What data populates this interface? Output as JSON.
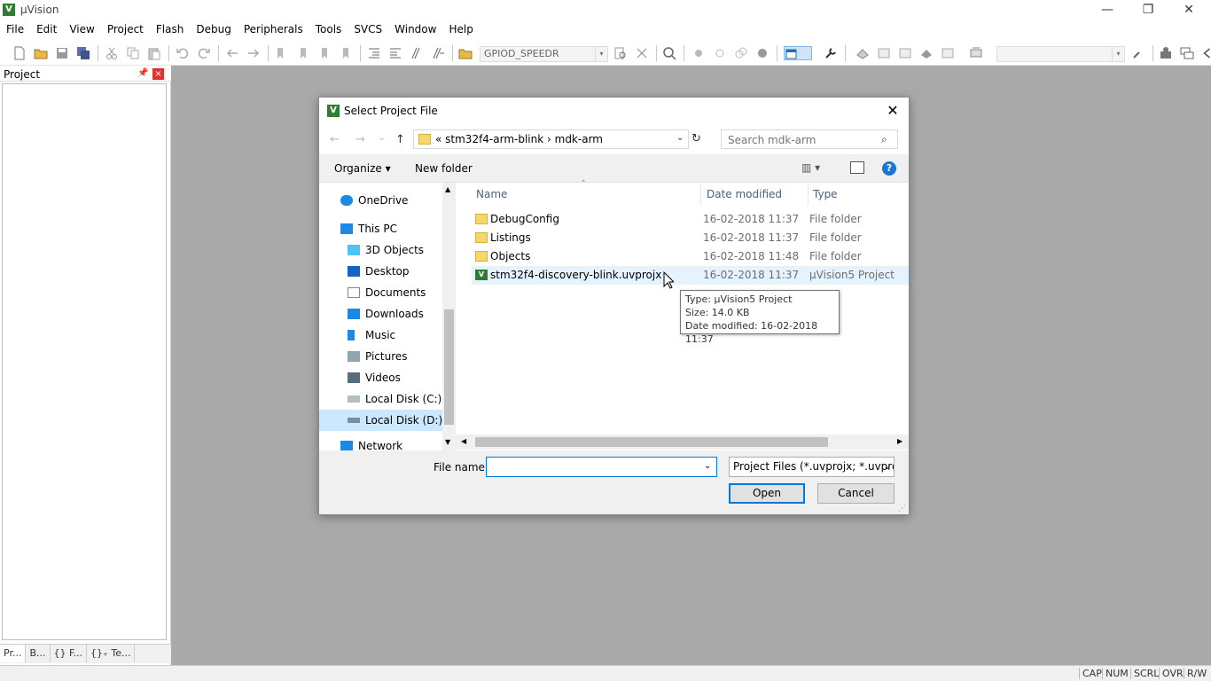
{
  "app": {
    "title": "µVision",
    "logo_letter": "V"
  },
  "window_controls": {
    "minimize": "—",
    "restore": "❐",
    "close": "✕"
  },
  "menu": [
    "File",
    "Edit",
    "View",
    "Project",
    "Flash",
    "Debug",
    "Peripherals",
    "Tools",
    "SVCS",
    "Window",
    "Help"
  ],
  "toolbar": {
    "target": "GPIOD_SPEEDR",
    "combo_arrow": "▾"
  },
  "project_panel": {
    "title": "Project",
    "pin": "📌",
    "close": "×",
    "tabs": [
      "Pr...",
      "B...",
      "{} F...",
      "{}₊ Te..."
    ]
  },
  "status": {
    "cap": "CAP",
    "num": "NUM",
    "scrl": "SCRL",
    "ovr": "OVR",
    "rw": "R/W"
  },
  "dialog": {
    "title": "Select Project File",
    "close": "✕",
    "nav": {
      "back": "←",
      "forward": "→",
      "recent": "⌄",
      "up": "↑"
    },
    "address": {
      "crumb": "«  stm32f4-arm-blink  ›  mdk-arm",
      "dropdown": "⌄",
      "refresh": "↻"
    },
    "search": {
      "placeholder": "Search mdk-arm",
      "icon": "⌕"
    },
    "organize": "Organize ▾",
    "new_folder": "New folder",
    "view": "▥  ▾",
    "help": "?",
    "nav_items": [
      {
        "label": "OneDrive"
      },
      {
        "label": "This PC"
      },
      {
        "label": "3D Objects"
      },
      {
        "label": "Desktop"
      },
      {
        "label": "Documents"
      },
      {
        "label": "Downloads"
      },
      {
        "label": "Music"
      },
      {
        "label": "Pictures"
      },
      {
        "label": "Videos"
      },
      {
        "label": "Local Disk (C:)"
      },
      {
        "label": "Local Disk (D:)",
        "selected": true
      },
      {
        "label": "Network"
      }
    ],
    "columns": {
      "name": "Name",
      "date": "Date modified",
      "type": "Type",
      "sort_arrow": "˄"
    },
    "files": [
      {
        "name": "DebugConfig",
        "date": "16-02-2018 11:37",
        "type": "File folder",
        "icon": "folder-icon"
      },
      {
        "name": "Listings",
        "date": "16-02-2018 11:37",
        "type": "File folder",
        "icon": "folder-icon"
      },
      {
        "name": "Objects",
        "date": "16-02-2018 11:48",
        "type": "File folder",
        "icon": "folder-icon"
      },
      {
        "name": "stm32f4-discovery-blink.uvprojx",
        "date": "16-02-2018 11:37",
        "type": "µVision5 Project",
        "icon": "uvision-project-icon"
      }
    ],
    "tooltip": {
      "type": "Type: µVision5 Project",
      "size": "Size: 14.0 KB",
      "date": "Date modified: 16-02-2018 11:37"
    },
    "file_name_label": "File name:",
    "file_name_value": "",
    "filter": "Project Files (*.uvprojx; *.uvpro",
    "open": "Open",
    "cancel": "Cancel",
    "arrows": {
      "up": "▲",
      "down": "▼",
      "left": "◀",
      "right": "▶",
      "drop": "⌄"
    }
  }
}
